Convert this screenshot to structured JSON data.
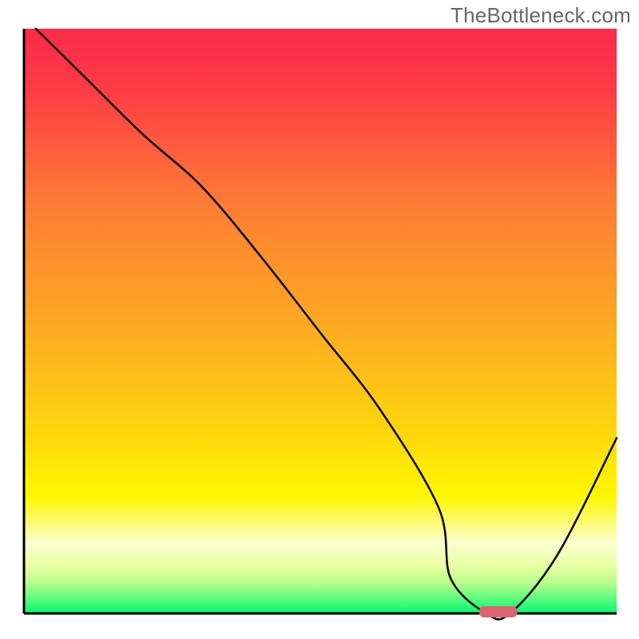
{
  "watermark": "TheBottleneck.com",
  "chart_data": {
    "type": "line",
    "title": "",
    "xlabel": "",
    "ylabel": "",
    "xlim": [
      0,
      100
    ],
    "ylim": [
      0,
      100
    ],
    "x": [
      2,
      10,
      20,
      30,
      40,
      50,
      60,
      70,
      72,
      78,
      82,
      90,
      100
    ],
    "values": [
      100,
      92,
      82,
      73,
      61,
      48,
      35,
      18,
      6,
      0,
      0,
      10,
      30
    ],
    "marker": {
      "x": 80,
      "y": 0,
      "width": 4,
      "color": "#d9636e"
    },
    "background_bands": [
      {
        "from": 100,
        "to": 25,
        "gradient": [
          "#fd2a4b",
          "#fea823",
          "#fef700"
        ]
      },
      {
        "from": 25,
        "to": 10,
        "color_top": "#fef700",
        "color_bot": "#fbfed0"
      },
      {
        "from": 10,
        "to": 2,
        "gradient": [
          "#f6feb4",
          "#6ffd81",
          "#00f76b"
        ]
      }
    ],
    "axes_color": "#000000",
    "curve_color": "#000000",
    "curve_width": 2.5
  }
}
